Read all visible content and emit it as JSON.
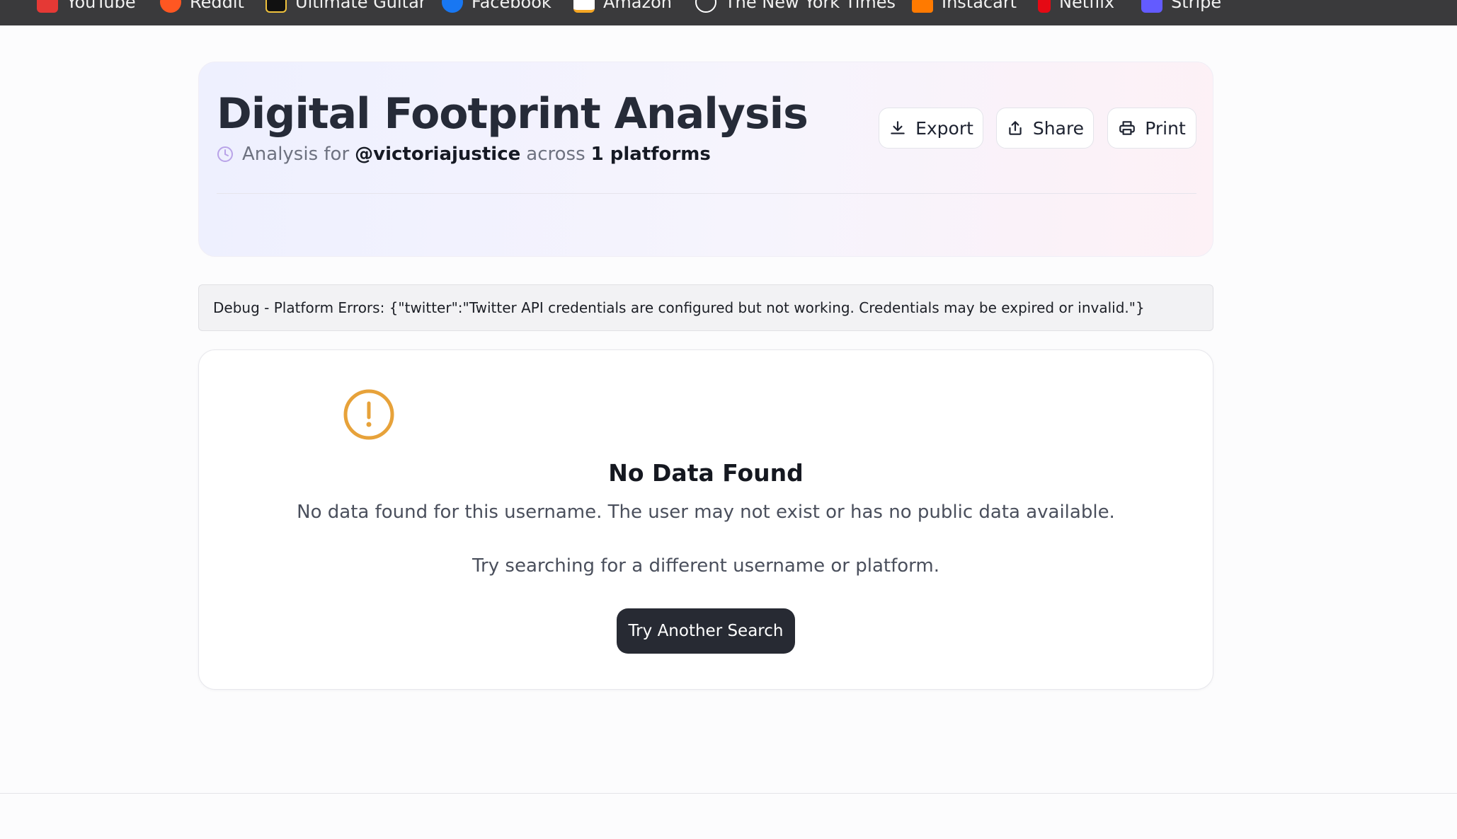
{
  "bookmarks": [
    {
      "label": "YouTube",
      "icon": "youtube-icon",
      "color": "#e53935"
    },
    {
      "label": "Reddit",
      "icon": "reddit-icon",
      "color": "#ff5722"
    },
    {
      "label": "Ultimate Guitar",
      "icon": "ultimate-guitar-icon",
      "color": "#111111"
    },
    {
      "label": "Facebook",
      "icon": "facebook-icon",
      "color": "#1877f2"
    },
    {
      "label": "Amazon",
      "icon": "amazon-icon",
      "color": "#f5a623"
    },
    {
      "label": "The New York Times",
      "icon": "nyt-icon",
      "color": "#ffffff"
    },
    {
      "label": "Instacart",
      "icon": "instacart-icon",
      "color": "#ff7a00"
    },
    {
      "label": "Netflix",
      "icon": "netflix-icon",
      "color": "#e50914"
    },
    {
      "label": "Stripe",
      "icon": "stripe-icon",
      "color": "#635bff"
    }
  ],
  "header": {
    "title": "Digital Footprint Analysis",
    "subtitle_prefix": "Analysis for",
    "username": "@victoriajustice",
    "subtitle_mid": "across",
    "platforms": "1 platforms",
    "actions": {
      "export": "Export",
      "share": "Share",
      "print": "Print"
    }
  },
  "debug": {
    "text": "Debug - Platform Errors: {\"twitter\":\"Twitter API credentials are configured but not working. Credentials may be expired or invalid.\"}"
  },
  "empty_state": {
    "title": "No Data Found",
    "message": "No data found for this username. The user may not exist or has no public data available.",
    "hint": "Try searching for a different username or platform.",
    "button": "Try Another Search"
  },
  "colors": {
    "accent_warning": "#e7a23a",
    "clock_accent": "#b9a3e8",
    "primary_button": "#272a33"
  }
}
